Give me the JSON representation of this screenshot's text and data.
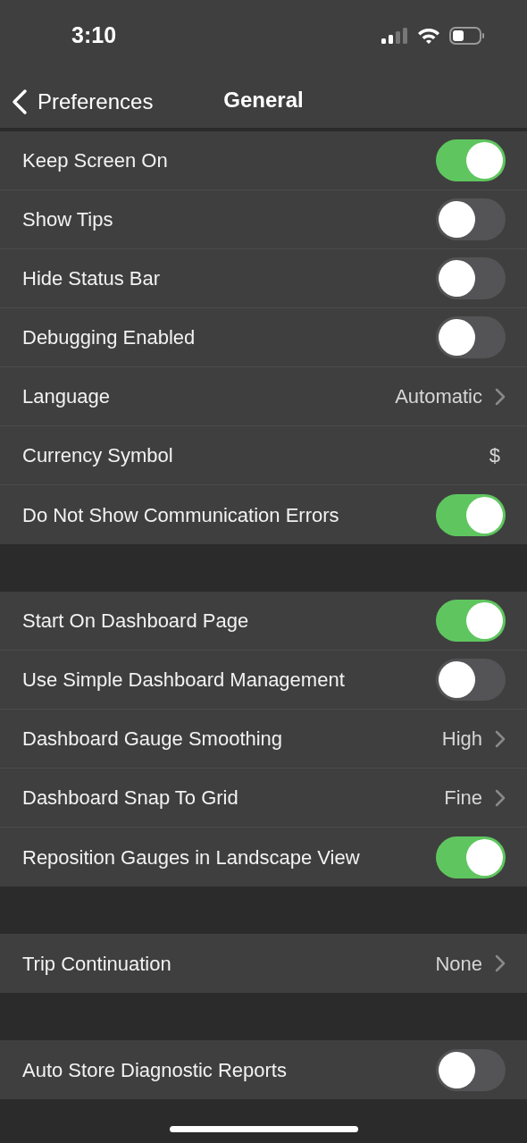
{
  "status_bar": {
    "time": "3:10"
  },
  "nav": {
    "back_label": "Preferences",
    "title": "General"
  },
  "sections": [
    {
      "rows": [
        {
          "kind": "toggle",
          "label": "Keep Screen On",
          "on": true
        },
        {
          "kind": "toggle",
          "label": "Show Tips",
          "on": false
        },
        {
          "kind": "toggle",
          "label": "Hide Status Bar",
          "on": false
        },
        {
          "kind": "toggle",
          "label": "Debugging Enabled",
          "on": false
        },
        {
          "kind": "disclosure",
          "label": "Language",
          "value": "Automatic"
        },
        {
          "kind": "value",
          "label": "Currency Symbol",
          "value": "$"
        },
        {
          "kind": "toggle",
          "label": "Do Not Show Communication Errors",
          "on": true
        }
      ]
    },
    {
      "rows": [
        {
          "kind": "toggle",
          "label": "Start On Dashboard Page",
          "on": true
        },
        {
          "kind": "toggle",
          "label": "Use Simple Dashboard Management",
          "on": false
        },
        {
          "kind": "disclosure",
          "label": "Dashboard Gauge Smoothing",
          "value": "High"
        },
        {
          "kind": "disclosure",
          "label": "Dashboard Snap To Grid",
          "value": "Fine"
        },
        {
          "kind": "toggle",
          "label": "Reposition Gauges in Landscape View",
          "on": true
        }
      ]
    },
    {
      "rows": [
        {
          "kind": "disclosure",
          "label": "Trip Continuation",
          "value": "None"
        }
      ]
    },
    {
      "rows": [
        {
          "kind": "toggle",
          "label": "Auto Store Diagnostic Reports",
          "on": false
        }
      ]
    }
  ]
}
